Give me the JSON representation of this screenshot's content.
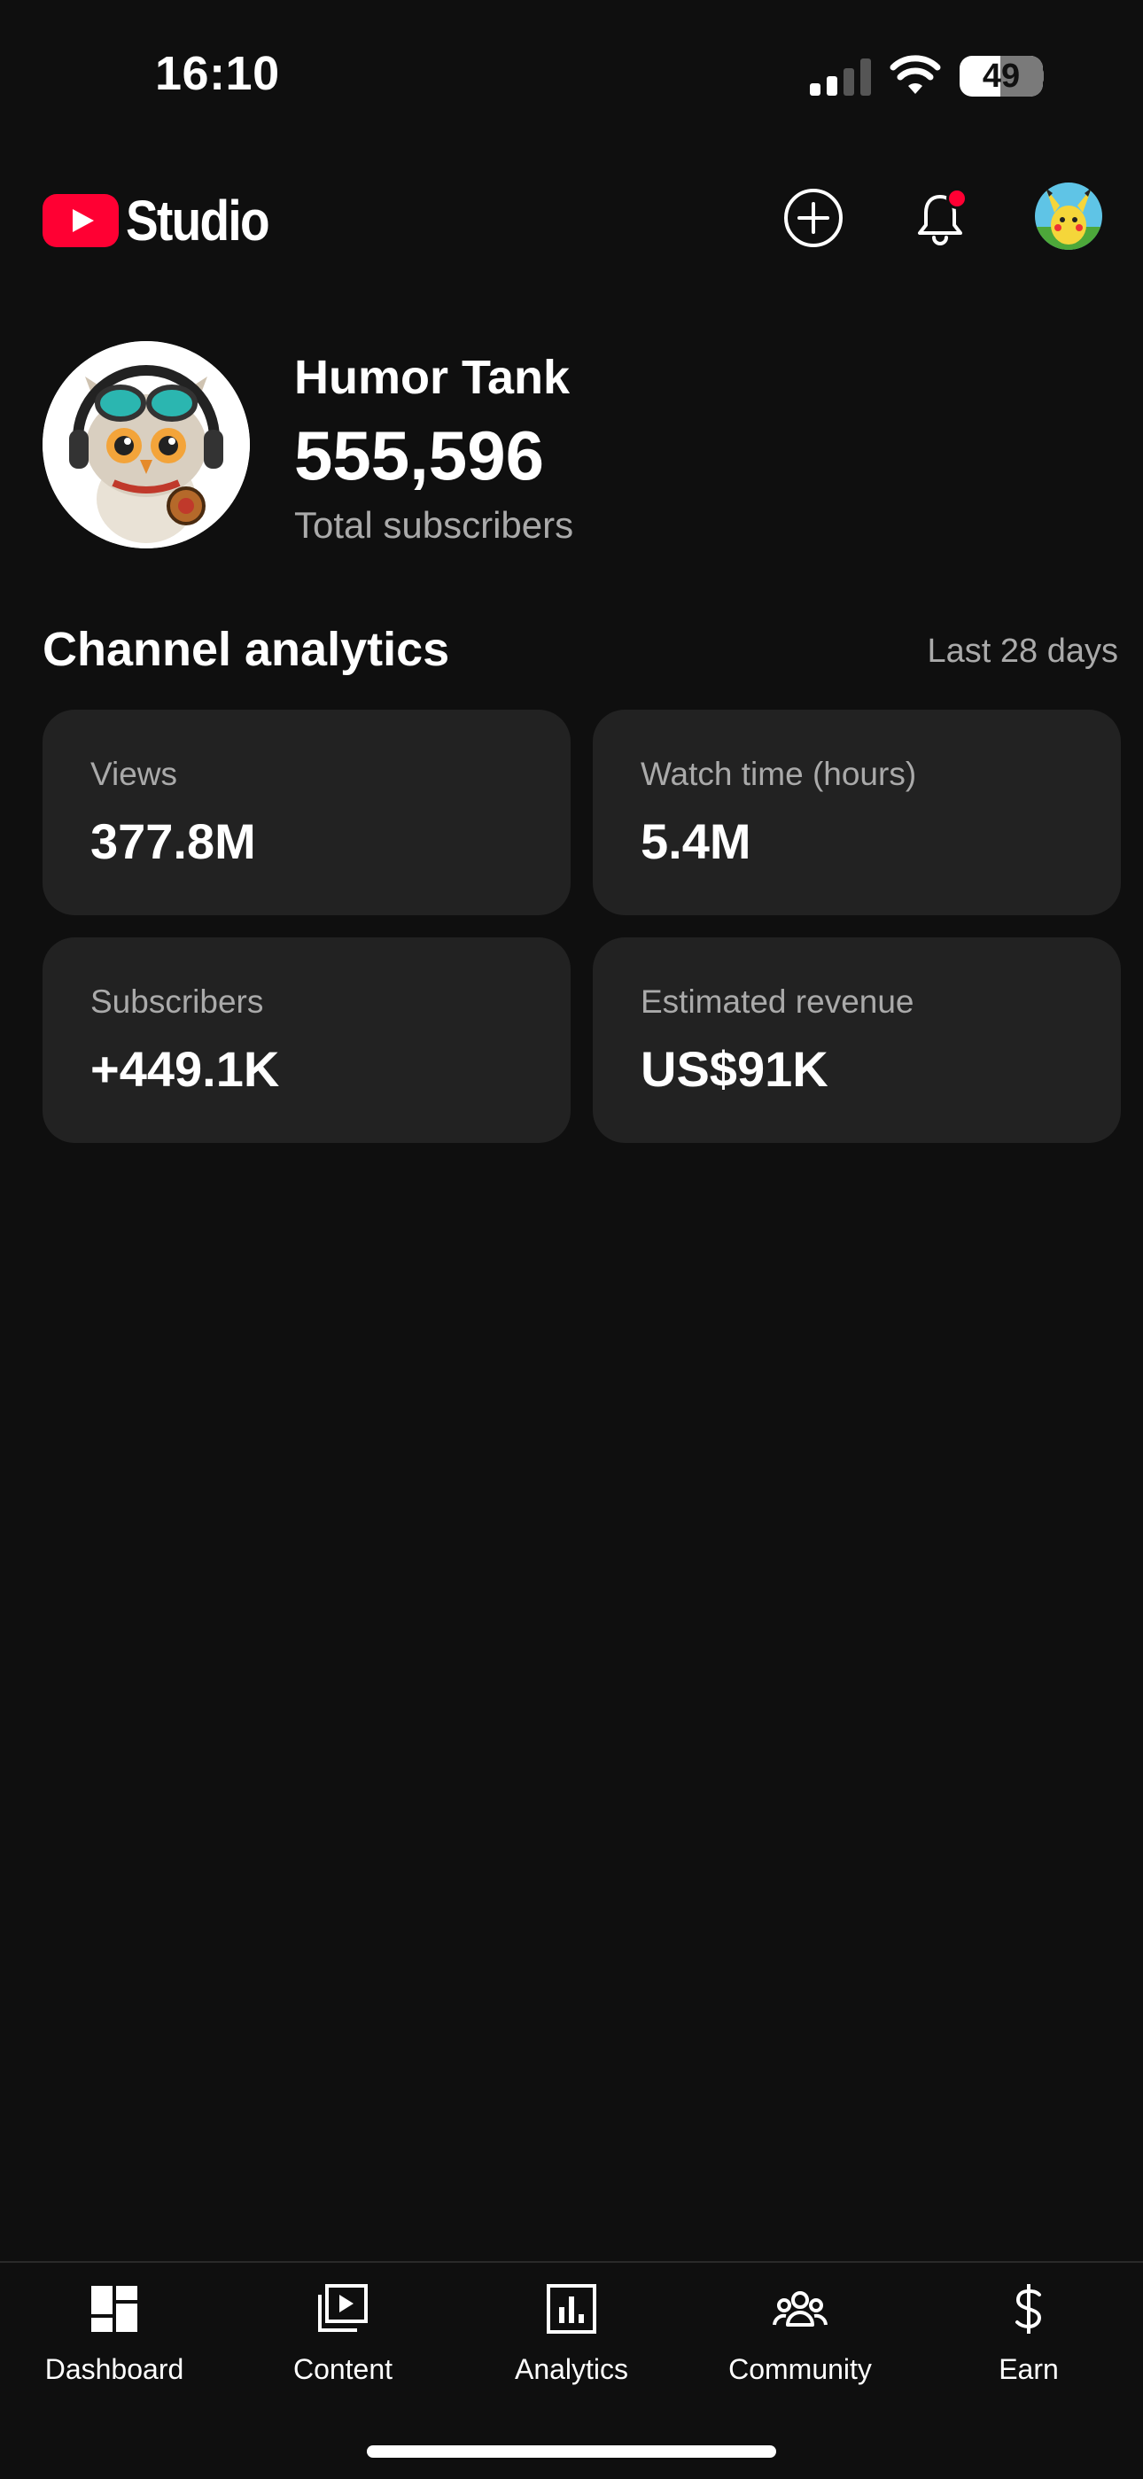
{
  "status_bar": {
    "time": "16:10",
    "battery_label": "49",
    "battery_level": 0.49,
    "icons": [
      "cellular-signal-icon",
      "wifi-icon",
      "battery-icon"
    ]
  },
  "header": {
    "brand_text": "Studio",
    "brand_color": "#ff0033",
    "icons": [
      "youtube-logo",
      "create-plus-icon",
      "notifications-bell-icon",
      "account-avatar"
    ],
    "notification_dot_color": "#ff0033"
  },
  "channel": {
    "name": "Humor Tank",
    "subscriber_count": "555,596",
    "subscriber_label": "Total subscribers"
  },
  "analytics": {
    "title": "Channel analytics",
    "period": "Last 28 days",
    "cards": [
      {
        "label": "Views",
        "value": "377.8M"
      },
      {
        "label": "Watch time (hours)",
        "value": "5.4M"
      },
      {
        "label": "Subscribers",
        "value": "+449.1K"
      },
      {
        "label": "Estimated revenue",
        "value": "US$91K"
      }
    ]
  },
  "bottom_nav": {
    "items": [
      {
        "label": "Dashboard",
        "icon": "dashboard-icon"
      },
      {
        "label": "Content",
        "icon": "content-play-icon"
      },
      {
        "label": "Analytics",
        "icon": "analytics-bar-icon"
      },
      {
        "label": "Community",
        "icon": "community-people-icon"
      },
      {
        "label": "Earn",
        "icon": "earn-dollar-icon"
      }
    ]
  }
}
